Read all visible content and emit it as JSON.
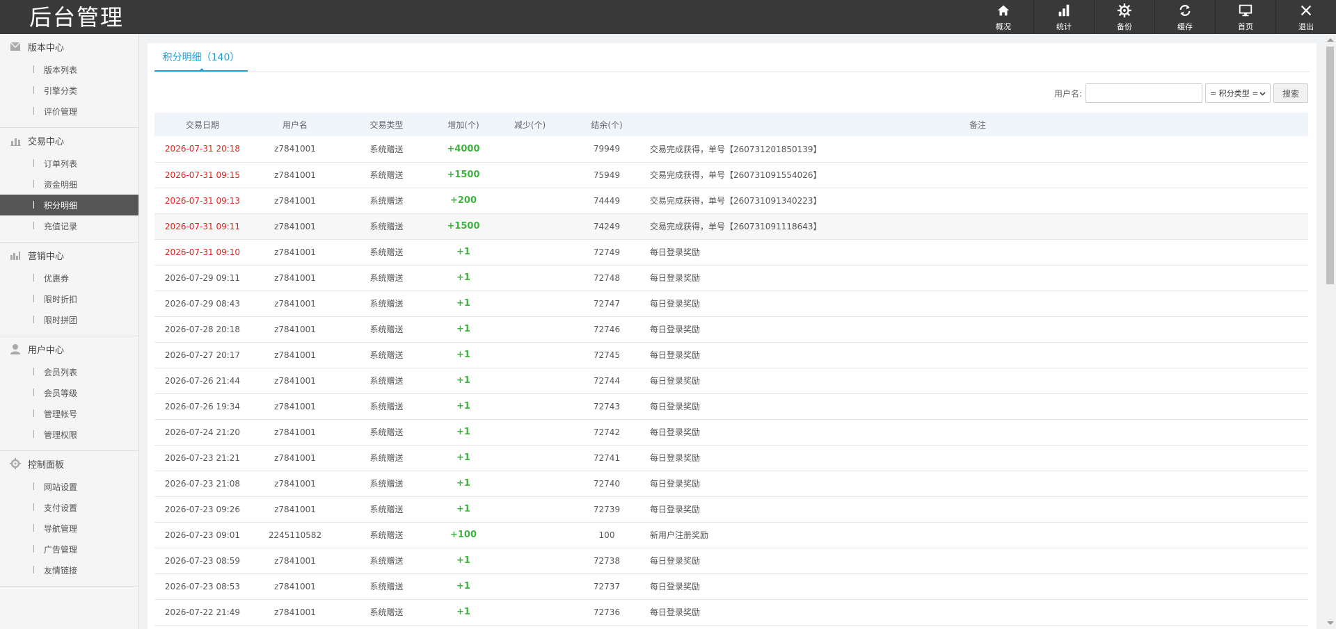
{
  "app": {
    "title": "后台管理"
  },
  "topnav": [
    {
      "label": "概况",
      "icon": "home-icon"
    },
    {
      "label": "统计",
      "icon": "stats-icon"
    },
    {
      "label": "备份",
      "icon": "gear-icon"
    },
    {
      "label": "缓存",
      "icon": "refresh-icon"
    },
    {
      "label": "首页",
      "icon": "monitor-icon"
    },
    {
      "label": "退出",
      "icon": "close-icon"
    }
  ],
  "sidebar": {
    "groups": [
      {
        "title": "版本中心",
        "icon": "mail-icon",
        "items": [
          "版本列表",
          "引擎分类",
          "评价管理"
        ]
      },
      {
        "title": "交易中心",
        "icon": "bar-chart-icon",
        "items": [
          "订单列表",
          "资金明细",
          "积分明细",
          "充值记录"
        ]
      },
      {
        "title": "营销中心",
        "icon": "chart-icon",
        "items": [
          "优惠券",
          "限时折扣",
          "限时拼团"
        ]
      },
      {
        "title": "用户中心",
        "icon": "user-icon",
        "items": [
          "会员列表",
          "会员等级",
          "管理帐号",
          "管理权限"
        ]
      },
      {
        "title": "控制面板",
        "icon": "settings-icon",
        "items": [
          "网站设置",
          "支付设置",
          "导航管理",
          "广告管理",
          "友情链接"
        ]
      }
    ],
    "active": "积分明细"
  },
  "tab": {
    "label": "积分明细（140）"
  },
  "search": {
    "label": "用户名:",
    "placeholder": "",
    "select_value": "= 积分类型 =",
    "button": "搜索"
  },
  "table": {
    "headers": [
      "交易日期",
      "用户名",
      "交易类型",
      "增加(个)",
      "减少(个)",
      "结余(个)",
      "备注"
    ],
    "rows": [
      {
        "date": "2026-07-31 20:18",
        "user": "z7841001",
        "type": "系统赠送",
        "add": "+4000",
        "sub": "",
        "balance": "79949",
        "note": "交易完成获得，单号【260731201850139】",
        "red": true
      },
      {
        "date": "2026-07-31 09:15",
        "user": "z7841001",
        "type": "系统赠送",
        "add": "+1500",
        "sub": "",
        "balance": "75949",
        "note": "交易完成获得，单号【260731091554026】",
        "red": true
      },
      {
        "date": "2026-07-31 09:13",
        "user": "z7841001",
        "type": "系统赠送",
        "add": "+200",
        "sub": "",
        "balance": "74449",
        "note": "交易完成获得，单号【260731091340223】",
        "red": true
      },
      {
        "date": "2026-07-31 09:11",
        "user": "z7841001",
        "type": "系统赠送",
        "add": "+1500",
        "sub": "",
        "balance": "74249",
        "note": "交易完成获得，单号【260731091118643】",
        "red": true
      },
      {
        "date": "2026-07-31 09:10",
        "user": "z7841001",
        "type": "系统赠送",
        "add": "+1",
        "sub": "",
        "balance": "72749",
        "note": "每日登录奖励",
        "red": true
      },
      {
        "date": "2026-07-29 09:11",
        "user": "z7841001",
        "type": "系统赠送",
        "add": "+1",
        "sub": "",
        "balance": "72748",
        "note": "每日登录奖励",
        "red": false
      },
      {
        "date": "2026-07-29 08:43",
        "user": "z7841001",
        "type": "系统赠送",
        "add": "+1",
        "sub": "",
        "balance": "72747",
        "note": "每日登录奖励",
        "red": false
      },
      {
        "date": "2026-07-28 20:18",
        "user": "z7841001",
        "type": "系统赠送",
        "add": "+1",
        "sub": "",
        "balance": "72746",
        "note": "每日登录奖励",
        "red": false
      },
      {
        "date": "2026-07-27 20:17",
        "user": "z7841001",
        "type": "系统赠送",
        "add": "+1",
        "sub": "",
        "balance": "72745",
        "note": "每日登录奖励",
        "red": false
      },
      {
        "date": "2026-07-26 21:44",
        "user": "z7841001",
        "type": "系统赠送",
        "add": "+1",
        "sub": "",
        "balance": "72744",
        "note": "每日登录奖励",
        "red": false
      },
      {
        "date": "2026-07-26 19:34",
        "user": "z7841001",
        "type": "系统赠送",
        "add": "+1",
        "sub": "",
        "balance": "72743",
        "note": "每日登录奖励",
        "red": false
      },
      {
        "date": "2026-07-24 21:20",
        "user": "z7841001",
        "type": "系统赠送",
        "add": "+1",
        "sub": "",
        "balance": "72742",
        "note": "每日登录奖励",
        "red": false
      },
      {
        "date": "2026-07-23 21:21",
        "user": "z7841001",
        "type": "系统赠送",
        "add": "+1",
        "sub": "",
        "balance": "72741",
        "note": "每日登录奖励",
        "red": false
      },
      {
        "date": "2026-07-23 21:08",
        "user": "z7841001",
        "type": "系统赠送",
        "add": "+1",
        "sub": "",
        "balance": "72740",
        "note": "每日登录奖励",
        "red": false
      },
      {
        "date": "2026-07-23 09:26",
        "user": "z7841001",
        "type": "系统赠送",
        "add": "+1",
        "sub": "",
        "balance": "72739",
        "note": "每日登录奖励",
        "red": false
      },
      {
        "date": "2026-07-23 09:01",
        "user": "2245110582",
        "type": "系统赠送",
        "add": "+100",
        "sub": "",
        "balance": "100",
        "note": "新用户注册奖励",
        "red": false
      },
      {
        "date": "2026-07-23 08:59",
        "user": "z7841001",
        "type": "系统赠送",
        "add": "+1",
        "sub": "",
        "balance": "72738",
        "note": "每日登录奖励",
        "red": false
      },
      {
        "date": "2026-07-23 08:53",
        "user": "z7841001",
        "type": "系统赠送",
        "add": "+1",
        "sub": "",
        "balance": "72737",
        "note": "每日登录奖励",
        "red": false
      },
      {
        "date": "2026-07-22 21:49",
        "user": "z7841001",
        "type": "系统赠送",
        "add": "+1",
        "sub": "",
        "balance": "72736",
        "note": "每日登录奖励",
        "red": false
      }
    ]
  },
  "colors": {
    "accent": "#1e9fd8",
    "topbar": "#393939",
    "red": "#e0201b",
    "green": "#3fb33f"
  }
}
